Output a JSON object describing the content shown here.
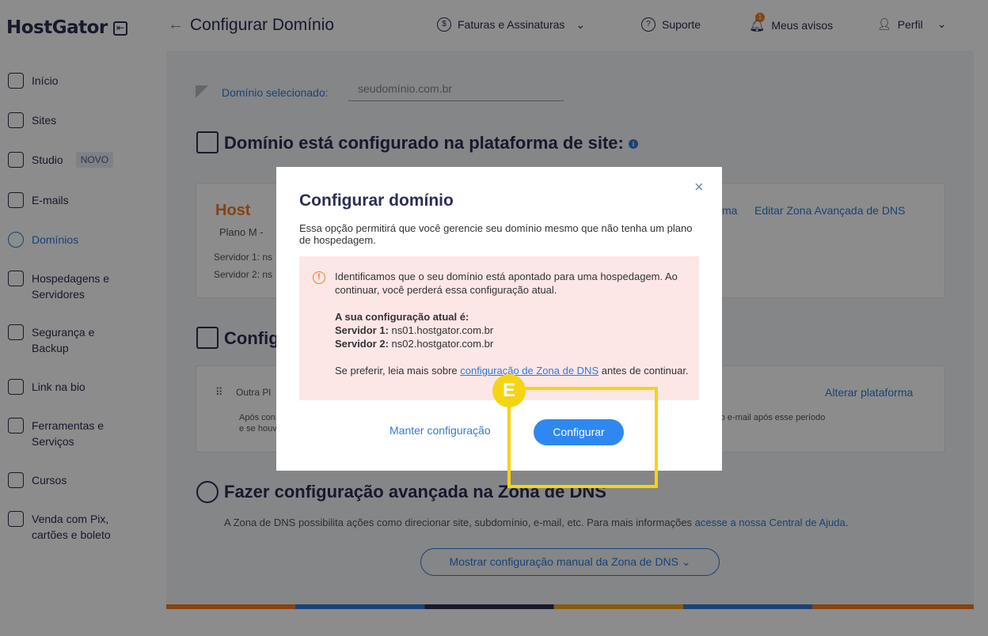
{
  "header": {
    "logo": "HostGator",
    "page_title": "Configurar Domínio",
    "nav": {
      "billing": "Faturas e Assinaturas",
      "support": "Suporte",
      "notices": "Meus avisos",
      "notice_count": "1",
      "profile": "Perfil"
    }
  },
  "sidebar": {
    "items": [
      {
        "label": "Início"
      },
      {
        "label": "Sites"
      },
      {
        "label": "Studio",
        "badge": "NOVO"
      },
      {
        "label": "E-mails"
      },
      {
        "label": "Domínios"
      },
      {
        "label": "Hospedagens e Servidores"
      },
      {
        "label": "Segurança e Backup"
      },
      {
        "label": "Link na bio"
      },
      {
        "label": "Ferramentas e Serviços"
      },
      {
        "label": "Cursos"
      },
      {
        "label": "Venda com Pix, cartões e boleto"
      }
    ]
  },
  "main": {
    "domain_label": "Domínio selecionado:",
    "domain_value": "seudomínio.com.br",
    "platform_title": "Domínio está configurado na plataforma de site:",
    "plan_brand": "Host",
    "plan_name": "Plano M -",
    "server1": "Servidor 1: ns",
    "server2": "Servidor 2: ns",
    "platform_link_partial": "ma",
    "edit_dns_link": "Editar Zona Avançada de DNS",
    "email_title_partial": "Config",
    "other_platform": "Outra Pl",
    "change_platform": "Alterar plataforma",
    "info_line1_partial": "Após con",
    "info_line2_partial": "e se houv",
    "info_right": "r o e-mail após esse período",
    "dns_title": "Fazer configuração avançada na Zona de DNS",
    "dns_desc": "A Zona de DNS possibilita ações como direcionar site, subdomínio, e-mail, etc. Para mais informações ",
    "dns_desc_link": "acesse a nossa Central de Ajuda",
    "dns_desc_end": ".",
    "show_manual_btn": "Mostrar configuração manual da Zona de DNS"
  },
  "modal": {
    "title": "Configurar domínio",
    "close": "×",
    "description": "Essa opção permitirá que você gerencie seu domínio mesmo que não tenha um plano de hospedagem.",
    "alert_line1": "Identificamos que o seu domínio está apontado para uma hospedagem. Ao continuar, você perderá essa configuração atual.",
    "alert_current_label": "A sua configuração atual é:",
    "server1_label": "Servidor 1:",
    "server1_value": " ns01.hostgator.com.br",
    "server2_label": "Servidor 2:",
    "server2_value": " ns02.hostgator.com.br",
    "prefer_text": "Se preferir, leia mais sobre ",
    "prefer_link": "configuração de Zona de DNS",
    "prefer_end": " antes de continuar.",
    "keep_button": "Manter configuração",
    "configure_button": "Configurar"
  },
  "annotation": {
    "badge": "E",
    "color": "#f5d414"
  }
}
